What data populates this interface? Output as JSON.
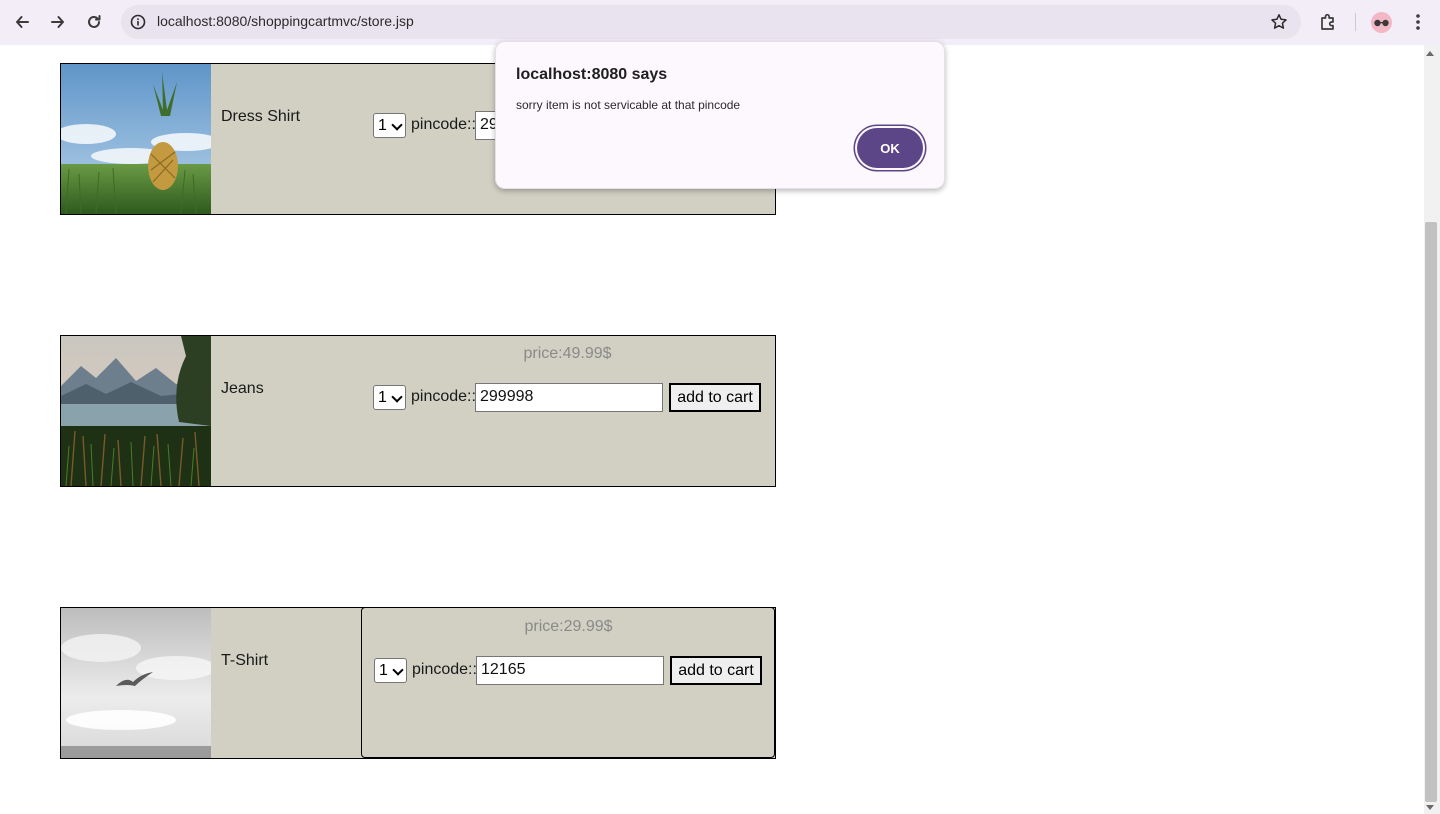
{
  "browser": {
    "url": "localhost:8080/shoppingcartmvc/store.jsp",
    "icons": [
      "back-arrow-icon",
      "forward-arrow-icon",
      "reload-icon",
      "site-info-icon",
      "bookmark-star-icon",
      "extensions-icon",
      "profile-avatar",
      "menu-kebab-icon"
    ]
  },
  "products": [
    {
      "name": "Dress Shirt",
      "quantity": "1",
      "pincode_label": "pincode::",
      "pincode_value": "29"
    },
    {
      "name": "Jeans",
      "price": "price:49.99$",
      "quantity": "1",
      "pincode_label": "pincode::",
      "pincode_value": "299998",
      "button_label": "add to cart"
    },
    {
      "name": "T-Shirt",
      "price": "price:29.99$",
      "quantity": "1",
      "pincode_label": "pincode::",
      "pincode_value": "12165",
      "button_label": "add to cart"
    }
  ],
  "dialog": {
    "title": "localhost:8080 says",
    "message": "sorry item is not servicable at that pincode",
    "ok_label": "OK",
    "accent": "#5c4687"
  },
  "colors": {
    "product_bg": "#d1d0c3",
    "browser_bar": "#f3edf7"
  }
}
